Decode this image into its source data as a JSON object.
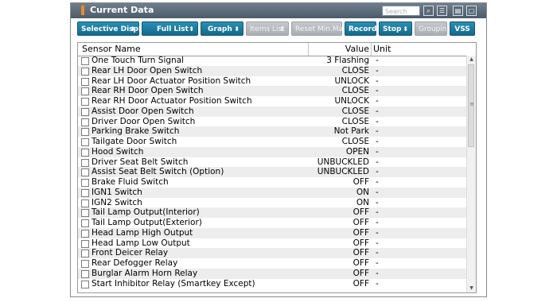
{
  "window": {
    "title": "Current Data",
    "search_placeholder": "Search"
  },
  "header_icons": [
    "magnifier-icon",
    "list-icon",
    "vss-icon",
    "window-icon"
  ],
  "header_icon_glyphs": [
    "⌕",
    "☰",
    "▤",
    "▢"
  ],
  "toolbar": {
    "buttons": [
      {
        "label": "Selective Display",
        "chevron": "⬍"
      },
      {
        "label": "Full List",
        "chevron": "⬍"
      },
      {
        "label": "Graph",
        "chevron": "⬍"
      },
      {
        "label": "Items List",
        "chevron": "⬍"
      },
      {
        "label": "Reset Min.Max"
      },
      {
        "label": "Record"
      },
      {
        "label": "Stop",
        "chevron": "⬍"
      },
      {
        "label": "Grouping"
      },
      {
        "label": "VSS"
      }
    ]
  },
  "table": {
    "columns": {
      "name": "Sensor Name",
      "value": "Value",
      "unit": "Unit"
    },
    "rows": [
      {
        "name": "One Touch Turn Signal",
        "value": "3 Flashing",
        "unit": "-"
      },
      {
        "name": "Rear LH Door Open Switch",
        "value": "CLOSE",
        "unit": "-"
      },
      {
        "name": "Rear LH Door Actuator Position Switch",
        "value": "UNLOCK",
        "unit": "-"
      },
      {
        "name": "Rear RH Door Open Switch",
        "value": "CLOSE",
        "unit": "-"
      },
      {
        "name": "Rear RH Door Actuator Position Switch",
        "value": "UNLOCK",
        "unit": "-"
      },
      {
        "name": "Assist Door Open Switch",
        "value": "CLOSE",
        "unit": "-"
      },
      {
        "name": "Driver Door Open Switch",
        "value": "CLOSE",
        "unit": "-"
      },
      {
        "name": "Parking Brake Switch",
        "value": "Not Park",
        "unit": "-"
      },
      {
        "name": "Tailgate Door Switch",
        "value": "CLOSE",
        "unit": "-"
      },
      {
        "name": "Hood Switch",
        "value": "OPEN",
        "unit": "-"
      },
      {
        "name": "Driver Seat Belt Switch",
        "value": "UNBUCKLED",
        "unit": "-"
      },
      {
        "name": "Assist Seat Belt Switch (Option)",
        "value": "UNBUCKLED",
        "unit": "-"
      },
      {
        "name": "Brake Fluid Switch",
        "value": "OFF",
        "unit": "-"
      },
      {
        "name": "IGN1 Switch",
        "value": "ON",
        "unit": "-"
      },
      {
        "name": "IGN2 Switch",
        "value": "ON",
        "unit": "-"
      },
      {
        "name": "Tail Lamp Output(Interior)",
        "value": "OFF",
        "unit": "-"
      },
      {
        "name": "Tail Lamp Output(Exterior)",
        "value": "OFF",
        "unit": "-"
      },
      {
        "name": "Head Lamp High Output",
        "value": "OFF",
        "unit": "-"
      },
      {
        "name": "Head Lamp Low Output",
        "value": "OFF",
        "unit": "-"
      },
      {
        "name": "Front Deicer Relay",
        "value": "OFF",
        "unit": "-"
      },
      {
        "name": "Rear Defogger Relay",
        "value": "OFF",
        "unit": "-"
      },
      {
        "name": "Burglar Alarm Horn Relay",
        "value": "OFF",
        "unit": "-"
      },
      {
        "name": "Start Inhibitor Relay (Smartkey Except)",
        "value": "OFF",
        "unit": "-"
      }
    ]
  },
  "scrollbar": {
    "up_glyph": "▲",
    "down_glyph": "▼",
    "grip_glyph": "≡"
  }
}
